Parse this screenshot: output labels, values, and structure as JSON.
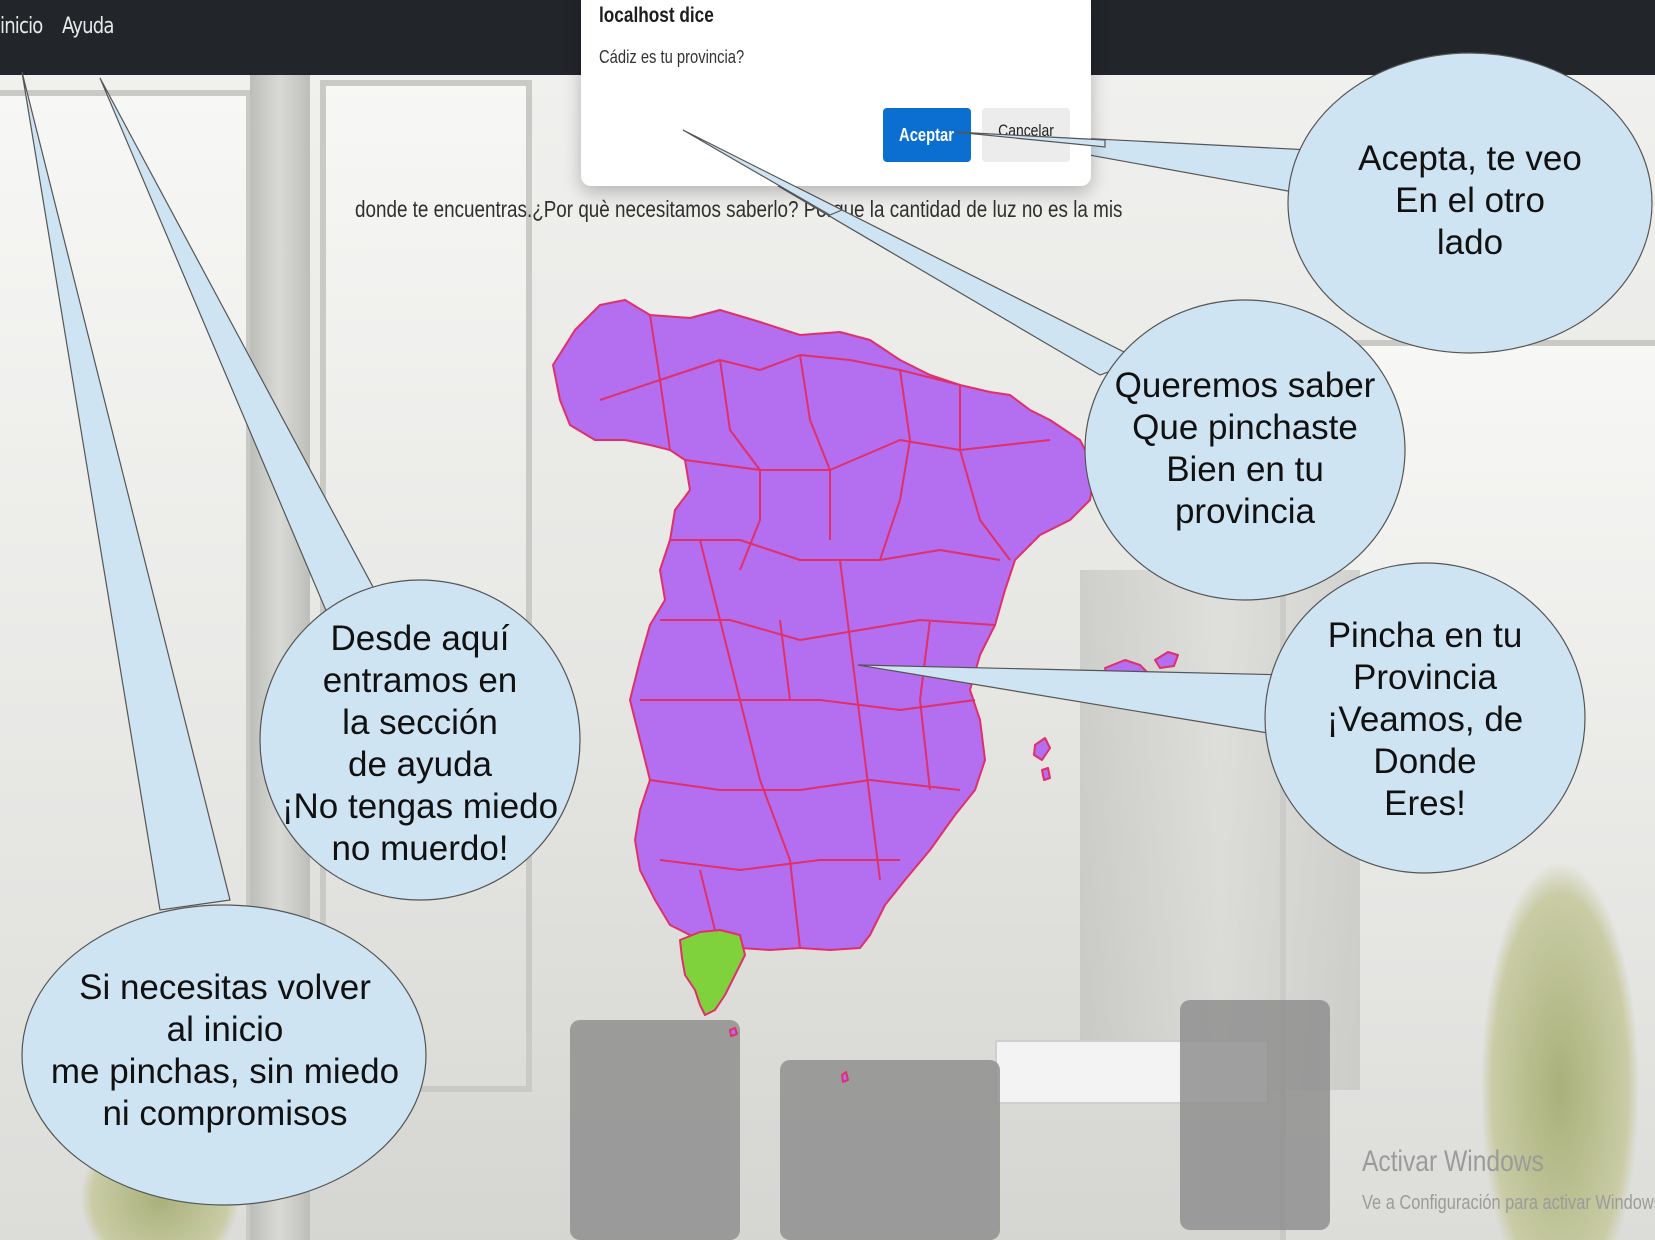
{
  "navbar": {
    "home_label": "inicio",
    "help_label": "Ayuda"
  },
  "dialog": {
    "title": "localhost dice",
    "message": "Cádiz es tu provincia?",
    "ok_label": "Aceptar",
    "cancel_label": "Cancelar"
  },
  "intro_text": "donde te encuentras.¿Por què necesitamos saberlo? Porque la cantidad de luz no es la misma en una zona que en ot",
  "map": {
    "region_color": "#b46ef0",
    "border_color": "#e0306a",
    "selected_color": "#7fd23c",
    "selected_region": "Cádiz"
  },
  "callouts": {
    "accept": [
      "Acepta, te veo",
      "En el otro",
      "lado"
    ],
    "province": [
      "Queremos saber",
      "Que pinchaste",
      "Bien en tu",
      "provincia"
    ],
    "click": [
      "Pincha en tu",
      "Provincia",
      "¡Veamos, de",
      "Donde",
      "Eres!"
    ],
    "help": [
      "Desde aquí",
      "entramos en",
      "la sección",
      "de ayuda",
      "¡No tengas miedo",
      "no muerdo!"
    ],
    "home": [
      "Si necesitas volver",
      "al inicio",
      "me pinchas, sin miedo",
      "ni compromisos"
    ]
  },
  "callout_fill": "#cfe4f2",
  "watermark": {
    "title": "Activar Windows",
    "subtitle": "Ve a Configuración para activar Windows"
  }
}
